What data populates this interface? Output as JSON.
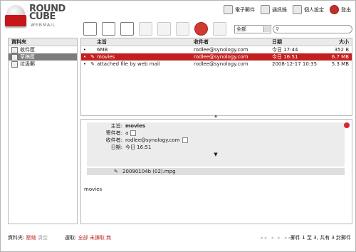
{
  "app": {
    "logo_line1": "ROUND",
    "logo_line2": "CUBE",
    "logo_sub": "WEBMAIL"
  },
  "topnav": [
    {
      "label": "電子郵件",
      "icon": "mail-icon"
    },
    {
      "label": "通訊錄",
      "icon": "addressbook-icon"
    },
    {
      "label": "個人設定",
      "icon": "settings-icon"
    },
    {
      "label": "登出",
      "icon": "logout-icon"
    }
  ],
  "toolbar": {
    "icons": [
      "check-mail-icon",
      "compose-icon",
      "select-icon",
      "reply-icon",
      "reply-all-icon",
      "forward-icon",
      "delete-icon",
      "print-icon"
    ],
    "filter_value": "全部",
    "search_placeholder": ""
  },
  "sidebar": {
    "header": "資料夾",
    "items": [
      {
        "label": "收件匣",
        "icon": "inbox-icon"
      },
      {
        "label": "草稿匣",
        "icon": "drafts-icon"
      },
      {
        "label": "垃圾郵",
        "icon": "trash-icon"
      }
    ]
  },
  "list": {
    "headers": {
      "subject": "主旨",
      "from": "收件者",
      "date": "日期",
      "size": "大小"
    },
    "rows": [
      {
        "subject": "6MB",
        "from": "rodlee@synology.com",
        "date": "今日 17:44",
        "size": "352 B",
        "attach": false
      },
      {
        "subject": "movies",
        "from": "rodlee@synology.com",
        "date": "今日 16:51",
        "size": "6.7 MB",
        "attach": true
      },
      {
        "subject": "attached file by web mail",
        "from": "rodlee@synology.com",
        "date": "2008-12-17 10:35",
        "size": "5.3 MB",
        "attach": true
      }
    ]
  },
  "preview": {
    "subject_label": "主旨:",
    "subject": "movies",
    "from_label": "寄件者:",
    "from": "a",
    "to_label": "收件者:",
    "to": "rodlee@synology.com",
    "date_label": "日期:",
    "date": "今日 16:51",
    "attachment": "20090104b (02).mpg",
    "body": "movies"
  },
  "status": {
    "left_label": "資料夾:",
    "left_a": "壓縮",
    "left_b": "清空",
    "mid_label": "選取:",
    "mid_a": "全部",
    "mid_b": "未讀取",
    "mid_c": "無",
    "pager": "◂◂ ◂ ▸ ▸▸",
    "right": "郵件 1 至 3, 共有 3 封郵件"
  },
  "colors": {
    "accent": "#c2201f",
    "selected_sidebar": "#7c7c7c"
  }
}
